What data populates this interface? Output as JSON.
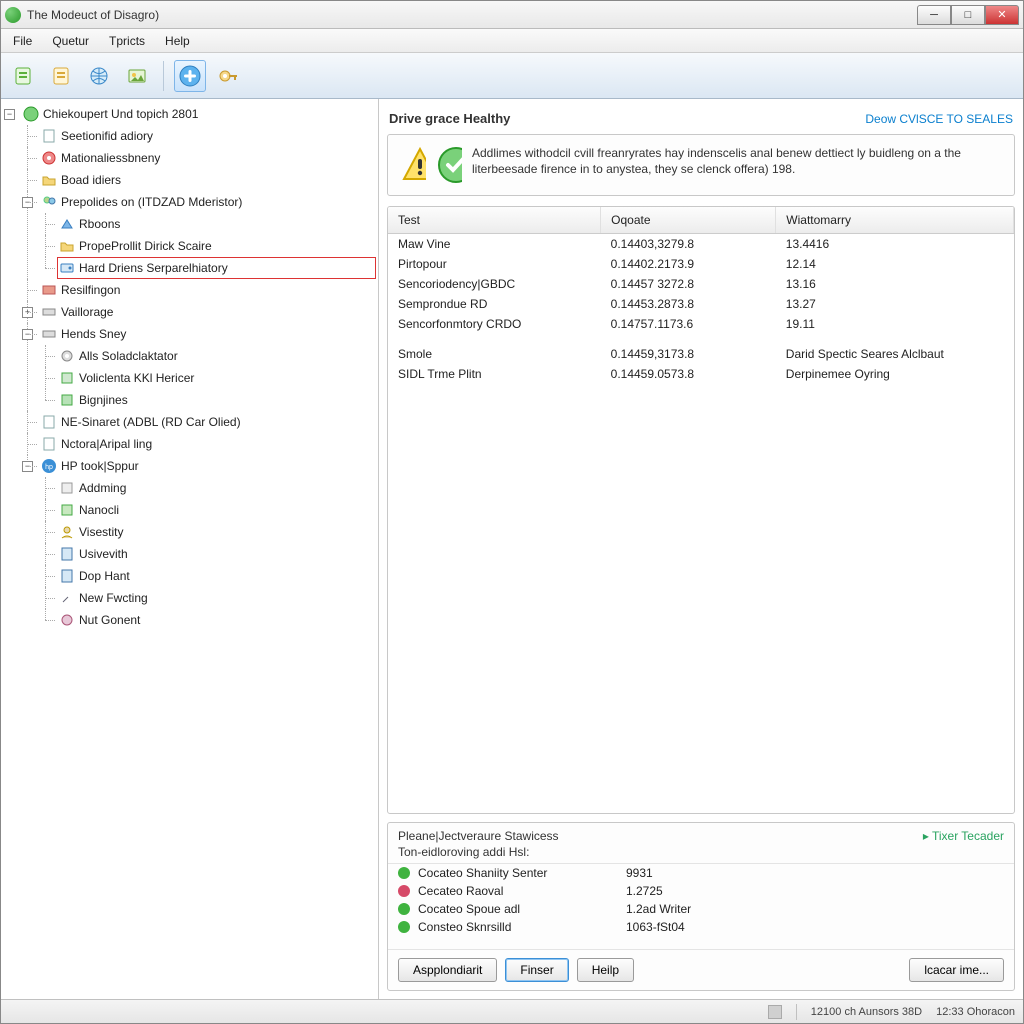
{
  "window": {
    "title": "The Modeuct of Disagro)"
  },
  "menu": {
    "file": "File",
    "quetur": "Quetur",
    "tpricts": "Tpricts",
    "help": "Help"
  },
  "tree": {
    "root": "Chiekoupert Und topich 2801",
    "n1": "Seetionifid adiory",
    "n2": "Mationaliessbneny",
    "n3": "Boad idiers",
    "n4": "Prepolides on (ITDZAD Mderistor)",
    "n4a": "Rboons",
    "n4b": "PropeProllit Dirick Scaire",
    "n4c": "Hard Driens Serparelhiatory",
    "n5": "Resilfingon",
    "n6": "Vaillorage",
    "n7": "Hends Sney",
    "n7a": "Alls Soladclaktator",
    "n7b": "Voliclenta KKl Hericer",
    "n7c": "Bignjines",
    "n8": "NE-Sinaret (ADBL (RD Car Olied)",
    "n9": "Nctora|Aripal ling",
    "n10": "HP took|Sppur",
    "n10a": "Addming",
    "n10b": "Nanocli",
    "n10c": "Visestity",
    "n10d": "Usivevith",
    "n10e": "Dop Hant",
    "n10f": "New Fwcting",
    "n10g": "Nut Gonent"
  },
  "panel": {
    "title": "Drive grace Healthy",
    "link": "Deow CVlSCE TO SEALES",
    "message": "Addlimes withodcil cvill freanryrates hay indenscelis anal benew dettiect ly buidleng on a the literbeesade firence in to anystea, they se clenck offera) 198."
  },
  "table": {
    "headers": {
      "test": "Test",
      "oqoate": "Oqoate",
      "wiattomarry": "Wiattomarry"
    },
    "rows": [
      {
        "test": "Maw Vine",
        "oqoate": "0.14403,3279.8",
        "w": "13.4416"
      },
      {
        "test": "Pirtopour",
        "oqoate": "0.14402.2173.9",
        "w": "12.14"
      },
      {
        "test": "Sencoriodency|GBDC",
        "oqoate": "0.14457 3272.8",
        "w": "13.16"
      },
      {
        "test": "Semprondue RD",
        "oqoate": "0.14453.2873.8",
        "w": "13.27"
      },
      {
        "test": "Sencorfonmtory CRDO",
        "oqoate": "0.14757.1173.6",
        "w": "19.11"
      }
    ],
    "rows2": [
      {
        "test": "Smole",
        "oqoate": "0.14459,3173.8",
        "w": "Darid Spectic Seares Alclbaut"
      },
      {
        "test": "SIDL Trme Plitn",
        "oqoate": "0.14459.0573.8",
        "w": "Derpinemee Oyring"
      }
    ]
  },
  "services": {
    "title": "Pleane|Jectveraure Stawicess",
    "sub": "Ton-eidloroving addi Hsl:",
    "link": "Tixer Tecader",
    "items": [
      {
        "name": "Cocateo Shaniity Senter",
        "val": "9931",
        "c": "#3fb33f"
      },
      {
        "name": "Cecateo Raoval",
        "val": "1.2725",
        "c": "#d64a68"
      },
      {
        "name": "Cocateo Spoue adl",
        "val": "1.2ad Writer",
        "c": "#3fb33f"
      },
      {
        "name": "Consteo Sknrsilld",
        "val": "1063-fSt04",
        "c": "#3fb33f"
      }
    ]
  },
  "buttons": {
    "appl": "Aspplondiarit",
    "finser": "Finser",
    "help": "Heilp",
    "lcacar": "lcacar ime..."
  },
  "status": {
    "left": "",
    "mid": "12100 ch Aunsors 38D",
    "right": "12:33 Ohoracon"
  }
}
